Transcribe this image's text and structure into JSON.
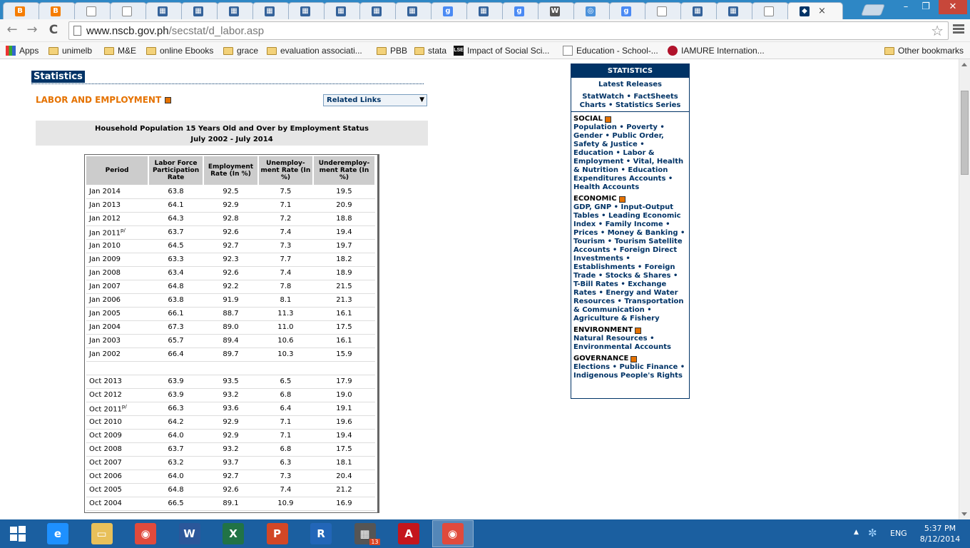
{
  "browser": {
    "tabs": [
      {
        "icon": "blogger-icon",
        "glyph": "B",
        "color": "#f57d00"
      },
      {
        "icon": "blogger-icon",
        "glyph": "B",
        "color": "#f57d00"
      },
      {
        "icon": "page-icon",
        "glyph": "",
        "color": "#ffffff"
      },
      {
        "icon": "page-icon",
        "glyph": "",
        "color": "#ffffff"
      },
      {
        "icon": "grid-icon",
        "glyph": "▦",
        "color": "#34629a"
      },
      {
        "icon": "grid-icon",
        "glyph": "▦",
        "color": "#34629a"
      },
      {
        "icon": "grid-icon",
        "glyph": "▦",
        "color": "#34629a"
      },
      {
        "icon": "grid-icon",
        "glyph": "▦",
        "color": "#34629a"
      },
      {
        "icon": "grid-icon",
        "glyph": "▦",
        "color": "#34629a"
      },
      {
        "icon": "grid-icon",
        "glyph": "▦",
        "color": "#34629a"
      },
      {
        "icon": "grid-icon",
        "glyph": "▦",
        "color": "#34629a"
      },
      {
        "icon": "grid-icon",
        "glyph": "▦",
        "color": "#34629a"
      },
      {
        "icon": "google-icon",
        "glyph": "g",
        "color": "#4a8af4"
      },
      {
        "icon": "grid-icon",
        "glyph": "▦",
        "color": "#34629a"
      },
      {
        "icon": "google-icon",
        "glyph": "g",
        "color": "#4a8af4"
      },
      {
        "icon": "wikipedia-icon",
        "glyph": "W",
        "color": "#555555"
      },
      {
        "icon": "un-icon",
        "glyph": "◎",
        "color": "#4b92db"
      },
      {
        "icon": "google-icon",
        "glyph": "g",
        "color": "#4a8af4"
      },
      {
        "icon": "page-icon",
        "glyph": "",
        "color": "#ffffff"
      },
      {
        "icon": "grid-icon",
        "glyph": "▦",
        "color": "#34629a"
      },
      {
        "icon": "grid-icon",
        "glyph": "▦",
        "color": "#34629a"
      },
      {
        "icon": "page-icon",
        "glyph": "",
        "color": "#ffffff"
      },
      {
        "icon": "nscb-icon",
        "glyph": "◆",
        "color": "#003366",
        "active": true
      }
    ],
    "close_glyph": "×",
    "url_host": "www.nscb.gov.ph",
    "url_path": "/secstat/d_labor.asp",
    "back_glyph": "←",
    "forward_glyph": "→",
    "reload_glyph": "C",
    "star_glyph": "☆",
    "min_glyph": "–",
    "max_glyph": "❐",
    "winclose_glyph": "✕"
  },
  "bookmarks": [
    {
      "label": "Apps",
      "type": "apps"
    },
    {
      "label": "unimelb",
      "type": "folder"
    },
    {
      "label": "M&E",
      "type": "folder"
    },
    {
      "label": "online Ebooks",
      "type": "folder"
    },
    {
      "label": "grace",
      "type": "folder"
    },
    {
      "label": "evaluation associati...",
      "type": "folder"
    },
    {
      "label": "PBB",
      "type": "folder"
    },
    {
      "label": "stata",
      "type": "folder"
    },
    {
      "label": "Impact of Social Sci...",
      "type": "lse"
    },
    {
      "label": "Education - School-...",
      "type": "page"
    },
    {
      "label": "IAMURE Internation...",
      "type": "iamure"
    },
    {
      "label": "Other bookmarks",
      "type": "folder"
    }
  ],
  "page": {
    "statistics_label": "Statistics",
    "section_title": "LABOR AND EMPLOYMENT",
    "related_links": "Related Links",
    "dropdown_glyph": "▼",
    "table_title_1": "Household Population 15 Years Old and Over by Employment Status",
    "table_title_2": "July 2002 - July 2014",
    "columns": [
      "Period",
      "Labor Force Participation Rate",
      "Employment Rate (In %)",
      "Unemploy- ment Rate (In %)",
      "Underemploy- ment Rate (In %)"
    ],
    "rows": [
      [
        "Jan 2014",
        "",
        "63.8",
        "92.5",
        "7.5",
        "19.5"
      ],
      [
        "Jan 2013",
        "",
        "64.1",
        "92.9",
        "7.1",
        "20.9"
      ],
      [
        "Jan 2012",
        "",
        "64.3",
        "92.8",
        "7.2",
        "18.8"
      ],
      [
        "Jan 2011",
        "p/",
        "63.7",
        "92.6",
        "7.4",
        "19.4"
      ],
      [
        "Jan 2010",
        "",
        "64.5",
        "92.7",
        "7.3",
        "19.7"
      ],
      [
        "Jan 2009",
        "",
        "63.3",
        "92.3",
        "7.7",
        "18.2"
      ],
      [
        "Jan 2008",
        "",
        "63.4",
        "92.6",
        "7.4",
        "18.9"
      ],
      [
        "Jan 2007",
        "",
        "64.8",
        "92.2",
        "7.8",
        "21.5"
      ],
      [
        "Jan 2006",
        "",
        "63.8",
        "91.9",
        "8.1",
        "21.3"
      ],
      [
        "Jan 2005",
        "",
        "66.1",
        "88.7",
        "11.3",
        "16.1"
      ],
      [
        "Jan 2004",
        "",
        "67.3",
        "89.0",
        "11.0",
        "17.5"
      ],
      [
        "Jan 2003",
        "",
        "65.7",
        "89.4",
        "10.6",
        "16.1"
      ],
      [
        "Jan 2002",
        "",
        "66.4",
        "89.7",
        "10.3",
        "15.9"
      ],
      [
        "",
        "",
        "",
        "",
        "",
        ""
      ],
      [
        "Oct 2013",
        "",
        "63.9",
        "93.5",
        "6.5",
        "17.9"
      ],
      [
        "Oct 2012",
        "",
        "63.9",
        "93.2",
        "6.8",
        "19.0"
      ],
      [
        "Oct 2011",
        "p/",
        "66.3",
        "93.6",
        "6.4",
        "19.1"
      ],
      [
        "Oct 2010",
        "",
        "64.2",
        "92.9",
        "7.1",
        "19.6"
      ],
      [
        "Oct 2009",
        "",
        "64.0",
        "92.9",
        "7.1",
        "19.4"
      ],
      [
        "Oct 2008",
        "",
        "63.7",
        "93.2",
        "6.8",
        "17.5"
      ],
      [
        "Oct 2007",
        "",
        "63.2",
        "93.7",
        "6.3",
        "18.1"
      ],
      [
        "Oct 2006",
        "",
        "64.0",
        "92.7",
        "7.3",
        "20.4"
      ],
      [
        "Oct 2005",
        "",
        "64.8",
        "92.6",
        "7.4",
        "21.2"
      ],
      [
        "Oct 2004",
        "",
        "66.5",
        "89.1",
        "10.9",
        "16.9"
      ]
    ]
  },
  "sidebar": {
    "header": "STATISTICS",
    "latest": "Latest Releases",
    "links_1": "StatWatch • FactSheets",
    "links_2": "Charts • Statistics Series",
    "sections": [
      {
        "title": "SOCIAL",
        "body": "Population • Poverty • Gender • Public Order, Safety & Justice • Education • Labor & Employment • Vital, Health & Nutrition • Education Expenditures Accounts • Health Accounts"
      },
      {
        "title": "ECONOMIC",
        "body": "GDP, GNP • Input-Output Tables • Leading Economic Index • Family Income • Prices • Money & Banking • Tourism • Tourism Satellite Accounts • Foreign Direct Investments • Establishments • Foreign Trade • Stocks & Shares • T-Bill Rates • Exchange Rates • Energy and Water Resources • Transportation & Communication • Agriculture & Fishery"
      },
      {
        "title": "ENVIRONMENT",
        "body": "Natural Resources • Environmental Accounts"
      },
      {
        "title": "GOVERNANCE",
        "body": "Elections • Public Finance • Indigenous People's Rights"
      }
    ]
  },
  "taskbar": {
    "apps": [
      {
        "icon": "ie-icon",
        "glyph": "e",
        "color": "#1e90ff"
      },
      {
        "icon": "file-explorer-icon",
        "glyph": "▭",
        "color": "#e8c05a"
      },
      {
        "icon": "chrome-icon",
        "glyph": "◉",
        "color": "#e04a3c"
      },
      {
        "icon": "word-icon",
        "glyph": "W",
        "color": "#2b579a"
      },
      {
        "icon": "excel-icon",
        "glyph": "X",
        "color": "#217346"
      },
      {
        "icon": "powerpoint-icon",
        "glyph": "P",
        "color": "#d24726"
      },
      {
        "icon": "r-icon",
        "glyph": "R",
        "color": "#2266b8"
      },
      {
        "icon": "calculator-icon",
        "glyph": "▦",
        "color": "#555555"
      },
      {
        "icon": "acrobat-icon",
        "glyph": "A",
        "color": "#c4161c"
      },
      {
        "icon": "chrome-icon",
        "glyph": "◉",
        "color": "#e04a3c",
        "active": true
      }
    ],
    "badge": "13",
    "lang": "ENG",
    "time": "5:37 PM",
    "date": "8/12/2014",
    "tray_arrow": "▲",
    "tray_icon": "✼"
  },
  "colors": {
    "navy": "#003366",
    "orange": "#e57200",
    "tabbar": "#2e87c5",
    "taskbar": "#1b5fa0"
  }
}
